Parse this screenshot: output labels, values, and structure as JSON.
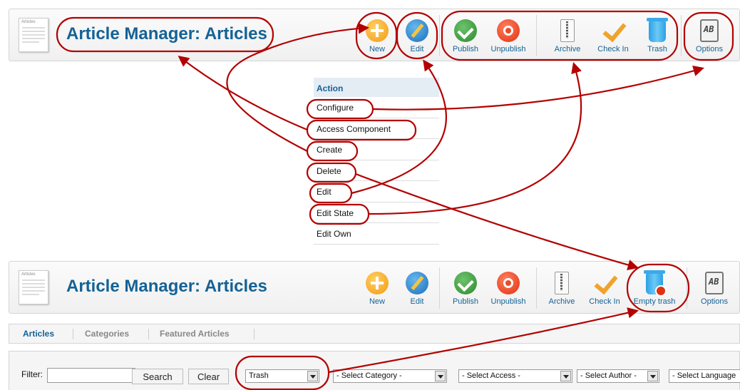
{
  "toolbar_top": {
    "icon_caption": "Articles",
    "title": "Article Manager: Articles",
    "buttons": [
      {
        "key": "new",
        "label": "New"
      },
      {
        "key": "edit",
        "label": "Edit"
      },
      {
        "key": "publish",
        "label": "Publish"
      },
      {
        "key": "unpublish",
        "label": "Unpublish"
      },
      {
        "key": "archive",
        "label": "Archive"
      },
      {
        "key": "checkin",
        "label": "Check In"
      },
      {
        "key": "trash",
        "label": "Trash"
      },
      {
        "key": "options",
        "label": "Options"
      }
    ]
  },
  "permissions": {
    "header": "Action",
    "rows": [
      "Configure",
      "Access Component",
      "Create",
      "Delete",
      "Edit",
      "Edit State",
      "Edit Own"
    ]
  },
  "toolbar_bottom": {
    "icon_caption": "Articles",
    "title": "Article Manager: Articles",
    "buttons": [
      {
        "key": "new",
        "label": "New"
      },
      {
        "key": "edit",
        "label": "Edit"
      },
      {
        "key": "publish",
        "label": "Publish"
      },
      {
        "key": "unpublish",
        "label": "Unpublish"
      },
      {
        "key": "archive",
        "label": "Archive"
      },
      {
        "key": "checkin",
        "label": "Check In"
      },
      {
        "key": "empty_trash",
        "label": "Empty trash"
      },
      {
        "key": "options",
        "label": "Options"
      }
    ]
  },
  "tabs": [
    "Articles",
    "Categories",
    "Featured Articles"
  ],
  "filters": {
    "label": "Filter:",
    "search_value": "",
    "search_button": "Search",
    "clear_button": "Clear",
    "selects": [
      "Trash",
      "- Select Category -",
      "- Select Access -",
      "- Select Author -",
      "- Select Language"
    ]
  },
  "colors": {
    "title": "#146295",
    "annotation": "#b30000"
  },
  "icons": {
    "new": "plus-circle-icon",
    "edit": "pencil-icon",
    "publish": "checkmark-icon",
    "unpublish": "unpublish-icon",
    "archive": "archive-icon",
    "checkin": "check-in-icon",
    "trash": "trash-icon",
    "empty_trash": "empty-trash-icon",
    "options": "options-icon"
  }
}
